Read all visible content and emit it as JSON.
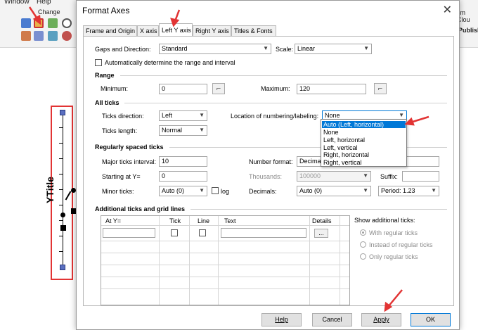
{
  "background_app": {
    "menu": [
      "Window",
      "Help"
    ],
    "ribbon_change_label": "Change",
    "ribbon_right_text": [
      "sm Clou",
      "Publish"
    ],
    "plot_y_title": "YTitle"
  },
  "dialog": {
    "title": "Format Axes",
    "close_glyph": "✕",
    "tabs": [
      "Frame and Origin",
      "X axis",
      "Left Y axis",
      "Right Y axis",
      "Titles & Fonts"
    ],
    "active_tab": "Left Y axis",
    "gaps_label": "Gaps and Direction:",
    "gaps_value": "Standard",
    "scale_label": "Scale:",
    "scale_value": "Linear",
    "auto_range_label": "Automatically determine the range and interval",
    "range": {
      "section": "Range",
      "minimum_label": "Minimum:",
      "minimum_value": "0",
      "maximum_label": "Maximum:",
      "maximum_value": "120"
    },
    "all_ticks": {
      "section": "All ticks",
      "direction_label": "Ticks direction:",
      "direction_value": "Left",
      "length_label": "Ticks length:",
      "length_value": "Normal",
      "location_label": "Location of numbering/labeling:",
      "location_value": "None",
      "location_options": [
        "Auto (Left, horizontal)",
        "None",
        "Left, horizontal",
        "Left, vertical",
        "Right, horizontal",
        "Right, vertical"
      ],
      "location_highlighted": "Auto (Left, horizontal)"
    },
    "regular": {
      "section": "Regularly spaced ticks",
      "major_label": "Major ticks interval:",
      "major_value": "10",
      "start_label": "Starting at Y=",
      "start_value": "0",
      "minor_label": "Minor ticks:",
      "minor_value": "Auto (0)",
      "log_label": "log",
      "number_format_label": "Number format:",
      "number_format_value": "Decimal",
      "thousands_label": "Thousands:",
      "thousands_value": "100000",
      "suffix_label": "Suffix:",
      "suffix_value": "",
      "decimals_label": "Decimals:",
      "decimals_value": "Auto (0)",
      "period_value": "Period: 1.23"
    },
    "additional": {
      "section": "Additional ticks and grid lines",
      "columns": [
        "At Y=",
        "Tick",
        "Line",
        "Text",
        "Details"
      ],
      "details_button": "...",
      "show_label": "Show additional ticks:",
      "show_options": [
        "With regular ticks",
        "Instead of regular ticks",
        "Only regular ticks"
      ],
      "show_selected": "With regular ticks"
    },
    "buttons": {
      "help": "Help",
      "cancel": "Cancel",
      "apply": "Apply",
      "ok": "OK"
    }
  },
  "colors": {
    "annotation_red": "#e23434",
    "highlight_blue": "#0078d7"
  }
}
